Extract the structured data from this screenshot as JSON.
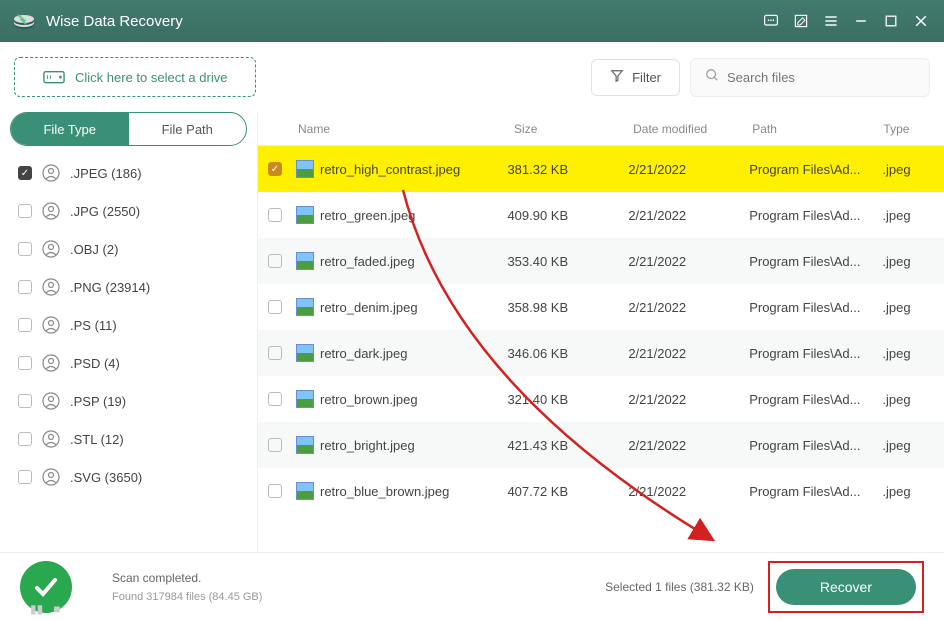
{
  "title": "Wise Data Recovery",
  "drive_selector_text": "Click here to select a drive",
  "filter_label": "Filter",
  "search_placeholder": "Search files",
  "sidebar_tabs": {
    "file_type": "File Type",
    "file_path": "File Path"
  },
  "sidebar_items": [
    {
      "label": ".JPEG (186)",
      "checked": true
    },
    {
      "label": ".JPG (2550)",
      "checked": false
    },
    {
      "label": ".OBJ (2)",
      "checked": false
    },
    {
      "label": ".PNG (23914)",
      "checked": false
    },
    {
      "label": ".PS (11)",
      "checked": false
    },
    {
      "label": ".PSD (4)",
      "checked": false
    },
    {
      "label": ".PSP (19)",
      "checked": false
    },
    {
      "label": ".STL (12)",
      "checked": false
    },
    {
      "label": ".SVG (3650)",
      "checked": false
    }
  ],
  "columns": {
    "name": "Name",
    "size": "Size",
    "date": "Date modified",
    "path": "Path",
    "type": "Type"
  },
  "files": [
    {
      "name": "retro_high_contrast.jpeg",
      "size": "381.32 KB",
      "date": "2/21/2022",
      "path": "Program Files\\Ad...",
      "type": ".jpeg",
      "selected": true
    },
    {
      "name": "retro_green.jpeg",
      "size": "409.90 KB",
      "date": "2/21/2022",
      "path": "Program Files\\Ad...",
      "type": ".jpeg",
      "selected": false
    },
    {
      "name": "retro_faded.jpeg",
      "size": "353.40 KB",
      "date": "2/21/2022",
      "path": "Program Files\\Ad...",
      "type": ".jpeg",
      "selected": false
    },
    {
      "name": "retro_denim.jpeg",
      "size": "358.98 KB",
      "date": "2/21/2022",
      "path": "Program Files\\Ad...",
      "type": ".jpeg",
      "selected": false
    },
    {
      "name": "retro_dark.jpeg",
      "size": "346.06 KB",
      "date": "2/21/2022",
      "path": "Program Files\\Ad...",
      "type": ".jpeg",
      "selected": false
    },
    {
      "name": "retro_brown.jpeg",
      "size": "321.40 KB",
      "date": "2/21/2022",
      "path": "Program Files\\Ad...",
      "type": ".jpeg",
      "selected": false
    },
    {
      "name": "retro_bright.jpeg",
      "size": "421.43 KB",
      "date": "2/21/2022",
      "path": "Program Files\\Ad...",
      "type": ".jpeg",
      "selected": false
    },
    {
      "name": "retro_blue_brown.jpeg",
      "size": "407.72 KB",
      "date": "2/21/2022",
      "path": "Program Files\\Ad...",
      "type": ".jpeg",
      "selected": false
    }
  ],
  "status": {
    "scan_completed": "Scan completed.",
    "found": "Found 317984 files (84.45 GB)",
    "selected": "Selected 1 files (381.32 KB)",
    "recover_label": "Recover"
  }
}
